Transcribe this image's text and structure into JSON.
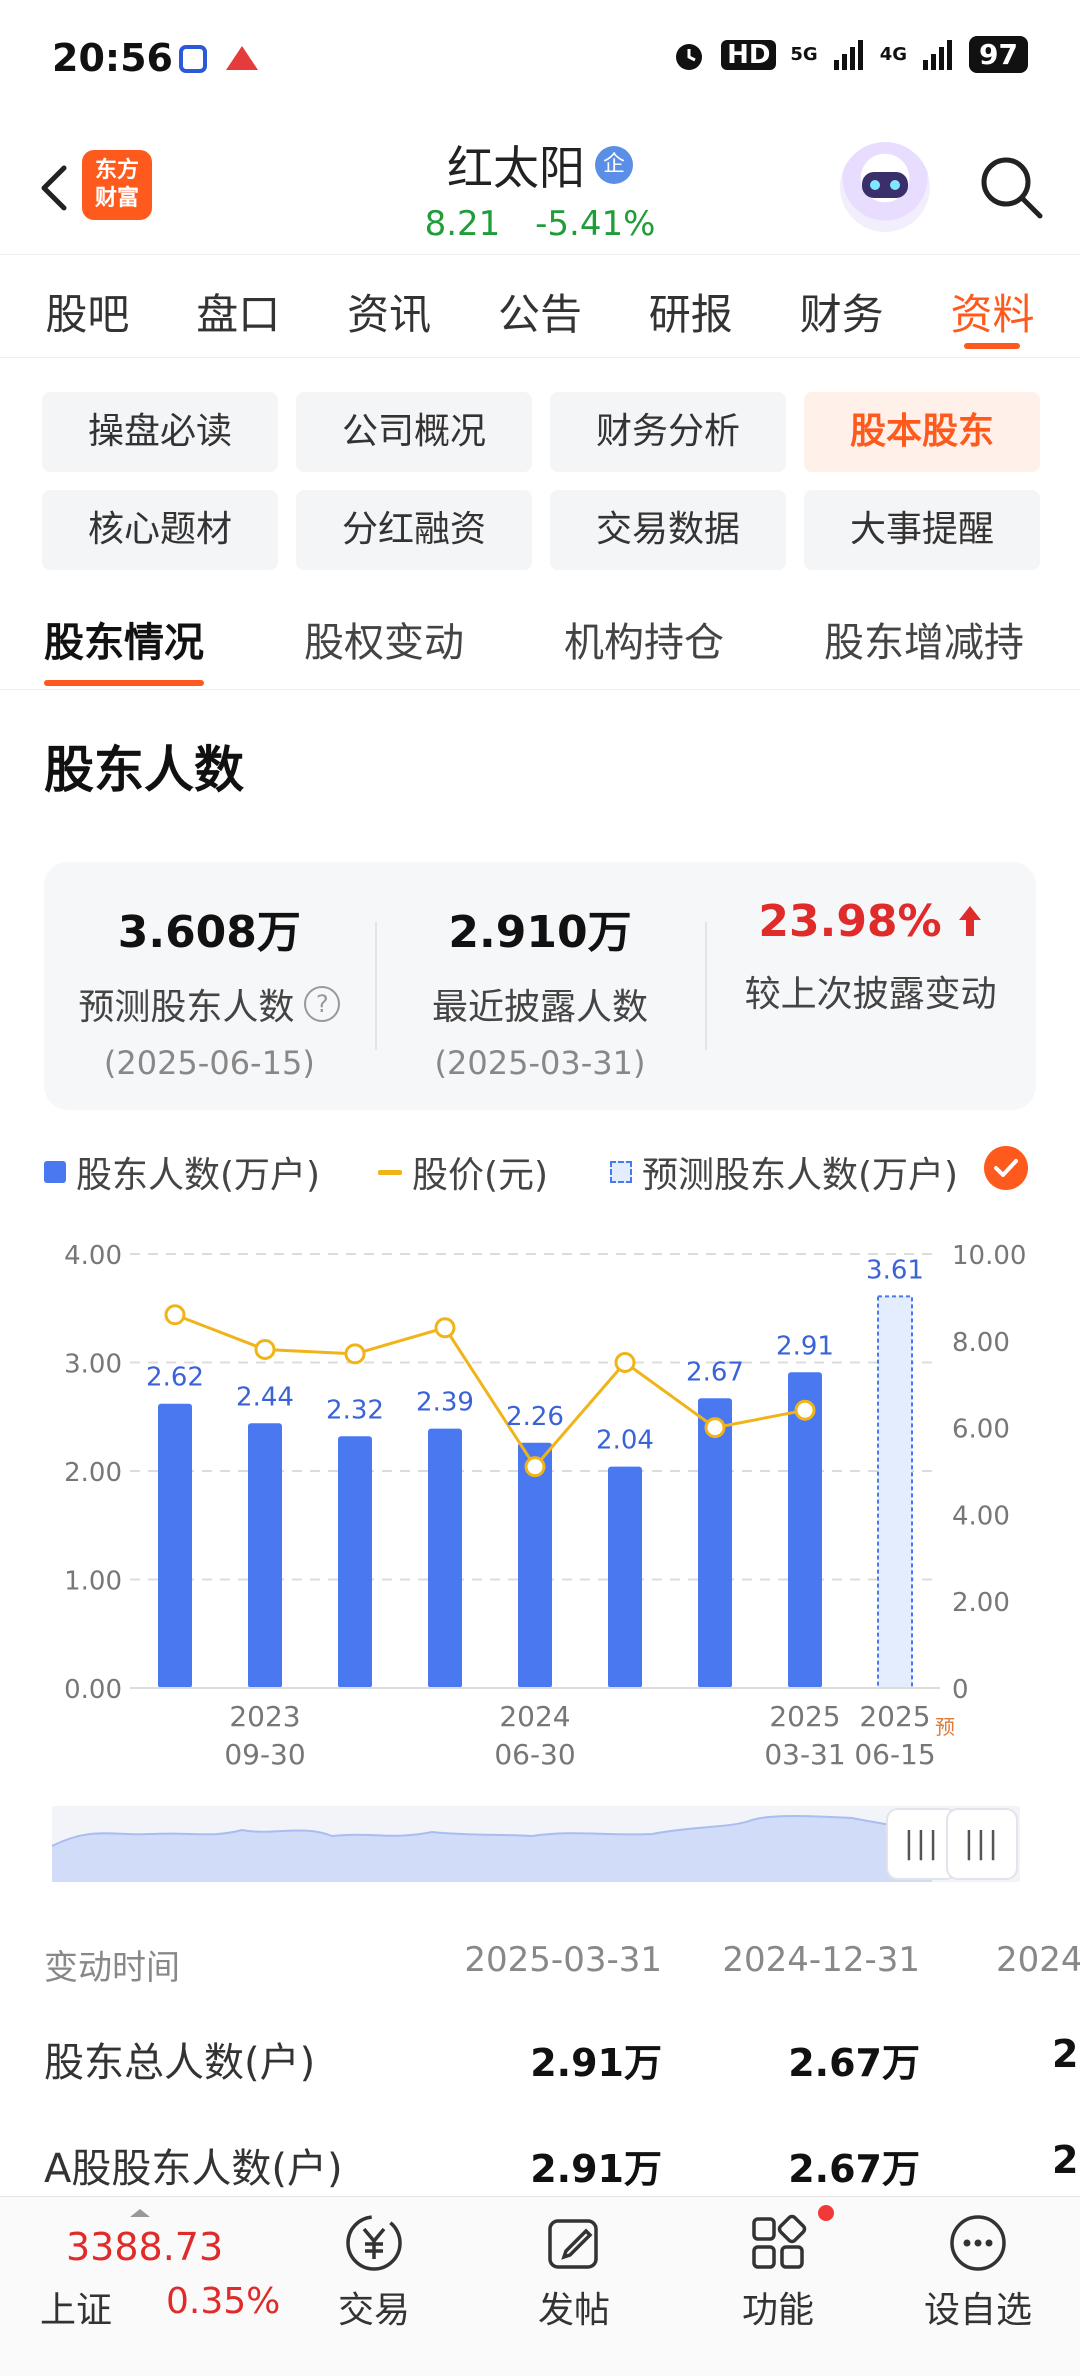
{
  "status_bar": {
    "time": "20:56",
    "network": "HD",
    "signal_label": "5G",
    "signal_label2": "4G",
    "battery": "97"
  },
  "header": {
    "back_icon": "chevron-left-icon",
    "logo_text_line1": "东方",
    "logo_text_line2": "财富",
    "stock_name": "红太阳",
    "badge": "企",
    "price": "8.21",
    "change_pct": "-5.41%",
    "search_icon": "search-icon"
  },
  "main_tabs": [
    "股吧",
    "盘口",
    "资讯",
    "公告",
    "研报",
    "财务",
    "资料"
  ],
  "main_tab_active": 6,
  "chips": [
    {
      "label": "操盘必读",
      "active": false
    },
    {
      "label": "公司概况",
      "active": false
    },
    {
      "label": "财务分析",
      "active": false
    },
    {
      "label": "股本股东",
      "active": true
    },
    {
      "label": "核心题材",
      "active": false
    },
    {
      "label": "分红融资",
      "active": false
    },
    {
      "label": "交易数据",
      "active": false
    },
    {
      "label": "大事提醒",
      "active": false
    }
  ],
  "sub_tabs": [
    "股东情况",
    "股权变动",
    "机构持仓",
    "股东增减持"
  ],
  "section_title": "股东人数",
  "stats": [
    {
      "value": "3.608万",
      "label": "预测股东人数",
      "date": "(2025-06-15)"
    },
    {
      "value": "2.910万",
      "label": "最近披露人数",
      "date": "(2025-03-31)"
    },
    {
      "value": "23.98%",
      "label": "较上次披露变动",
      "date": ""
    }
  ],
  "legend": {
    "bar": "股东人数(万户)",
    "line": "股价(元)",
    "pred": "预测股东人数(万户)"
  },
  "chart_data": {
    "type": "bar",
    "series": [
      {
        "name": "股东人数(万户)",
        "values": [
          2.62,
          2.44,
          2.32,
          2.39,
          2.26,
          2.04,
          2.67,
          2.91,
          null
        ]
      },
      {
        "name": "股价(元)",
        "values": [
          8.6,
          7.8,
          7.7,
          8.3,
          5.1,
          7.5,
          6.0,
          6.4,
          null
        ]
      },
      {
        "name": "预测股东人数(万户)",
        "values": [
          null,
          null,
          null,
          null,
          null,
          null,
          null,
          null,
          3.61
        ]
      }
    ],
    "bar_labels": [
      "2.62",
      "2.44",
      "2.32",
      "2.39",
      "2.26",
      "2.04",
      "2.67",
      "2.91",
      "3.61"
    ],
    "left_ticks": [
      "0.00",
      "1.00",
      "2.00",
      "3.00",
      "4.00"
    ],
    "right_ticks": [
      "0",
      "2.00",
      "4.00",
      "6.00",
      "8.00",
      "10.00"
    ],
    "ylim_left": [
      0,
      4
    ],
    "ylim_right": [
      0,
      10
    ],
    "x_labels": [
      {
        "index": 1,
        "year": "2023",
        "date": "09-30"
      },
      {
        "index": 4,
        "year": "2024",
        "date": "06-30"
      },
      {
        "index": 7,
        "year": "2025",
        "date": "03-31"
      },
      {
        "index": 8,
        "year": "2025",
        "date": "06-15"
      }
    ],
    "pred_mark": "预",
    "grid": true,
    "colors": {
      "bar": "#4a78f0",
      "line": "#f0b419",
      "pred_fill": "#e3edfd",
      "label": "#3a63d8"
    }
  },
  "slider": {
    "handle_glyph": "|||"
  },
  "table": {
    "header": {
      "label": "变动时间",
      "cols": [
        "2025-03-31",
        "2024-12-31",
        "2024"
      ]
    },
    "rows": [
      {
        "label": "股东总人数(户)",
        "cols": [
          "2.91万",
          "2.67万",
          "2"
        ]
      },
      {
        "label": "A股股东人数(户)",
        "cols": [
          "2.91万",
          "2.67万",
          "2"
        ]
      }
    ]
  },
  "bottom_bar": {
    "index_value": "3388.73",
    "index_name": "上证",
    "index_change": "0.35%",
    "nav": [
      {
        "label": "交易",
        "icon": "trade-yen-icon"
      },
      {
        "label": "发帖",
        "icon": "edit-post-icon"
      },
      {
        "label": "功能",
        "icon": "grid-apps-icon"
      },
      {
        "label": "设自选",
        "icon": "more-dots-icon"
      }
    ]
  },
  "colors": {
    "accent": "#ff5a1e",
    "down": "#1f9d3a",
    "up": "#e02b2b"
  }
}
